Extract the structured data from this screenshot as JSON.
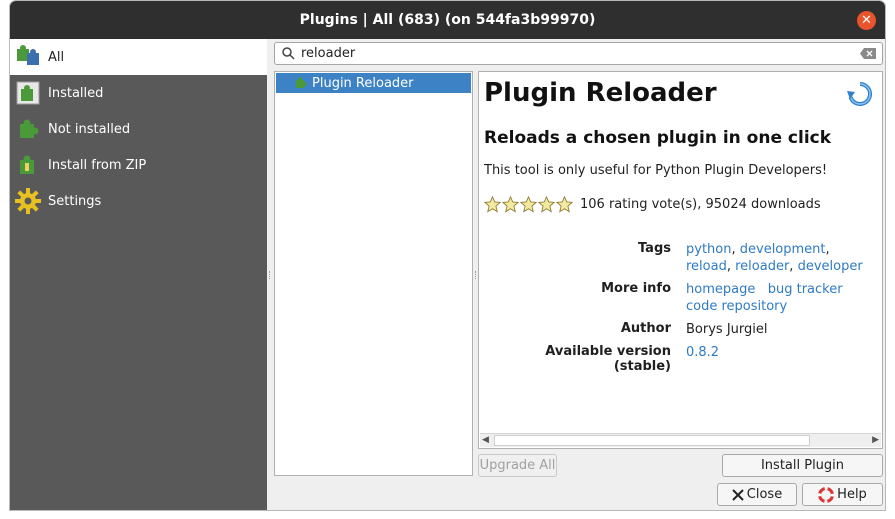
{
  "window": {
    "title": "Plugins | All (683) (on 544fa3b99970)"
  },
  "sidebar": {
    "items": [
      {
        "label": "All",
        "icon": "puzzle-all-icon",
        "active": true
      },
      {
        "label": "Installed",
        "icon": "puzzle-installed-icon"
      },
      {
        "label": "Not installed",
        "icon": "puzzle-not-installed-icon"
      },
      {
        "label": "Install from ZIP",
        "icon": "puzzle-zip-icon"
      },
      {
        "label": "Settings",
        "icon": "gear-icon"
      }
    ]
  },
  "search": {
    "value": "reloader"
  },
  "plugin_list": [
    {
      "label": "Plugin Reloader",
      "selected": true
    }
  ],
  "detail": {
    "title": "Plugin Reloader",
    "subtitle": "Reloads a chosen plugin in one click",
    "description": "This tool is only useful for Python Plugin Developers!",
    "rating_text": "106 rating vote(s), 95024 downloads",
    "stars": 5,
    "tags_label": "Tags",
    "tags": [
      "python",
      "development",
      "reload",
      "reloader",
      "developer"
    ],
    "more_info_label": "More info",
    "more_info_links": [
      "homepage",
      "bug tracker",
      "code repository"
    ],
    "author_label": "Author",
    "author": "Borys Jurgiel",
    "version_label": "Available version (stable)",
    "version": "0.8.2"
  },
  "buttons": {
    "upgrade_all": "Upgrade All",
    "install_plugin": "Install Plugin",
    "close": "Close",
    "help": "Help"
  },
  "colors": {
    "accent": "#3c82c4",
    "link": "#2e7bc4",
    "sidebar": "#595959",
    "titlebar": "#2f2f2f"
  }
}
